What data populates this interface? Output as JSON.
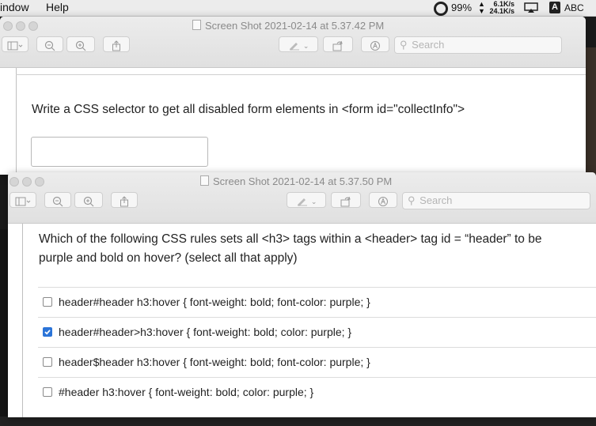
{
  "menubar": {
    "items": [
      "indow",
      "Help"
    ],
    "battery": "99%",
    "net_up": "6.1K/s",
    "net_down": "24.1K/s",
    "input_badge": "A",
    "input_label": "ABC"
  },
  "window_back": {
    "title": "Screen Shot 2021-02-14 at 5.37.42 PM",
    "search_placeholder": "Search",
    "question": "Write a CSS selector to get all disabled form elements in <form id=\"collectInfo\">",
    "answer_value": ""
  },
  "window_front": {
    "title": "Screen Shot 2021-02-14 at 5.37.50 PM",
    "search_placeholder": "Search",
    "question": "Which of the following CSS rules sets all <h3> tags within a <header> tag id = “header” to be purple and bold on hover? (select all that apply)",
    "options": [
      {
        "label": "header#header h3:hover { font-weight: bold; font-color: purple; }",
        "checked": false
      },
      {
        "label": "header#header>h3:hover { font-weight: bold; color: purple; }",
        "checked": true
      },
      {
        "label": "header$header h3:hover { font-weight: bold; font-color: purple; }",
        "checked": false
      },
      {
        "label": "#header h3:hover { font-weight: bold; color: purple; }",
        "checked": false
      }
    ]
  },
  "colors": {
    "accent": "#2b74d8"
  }
}
